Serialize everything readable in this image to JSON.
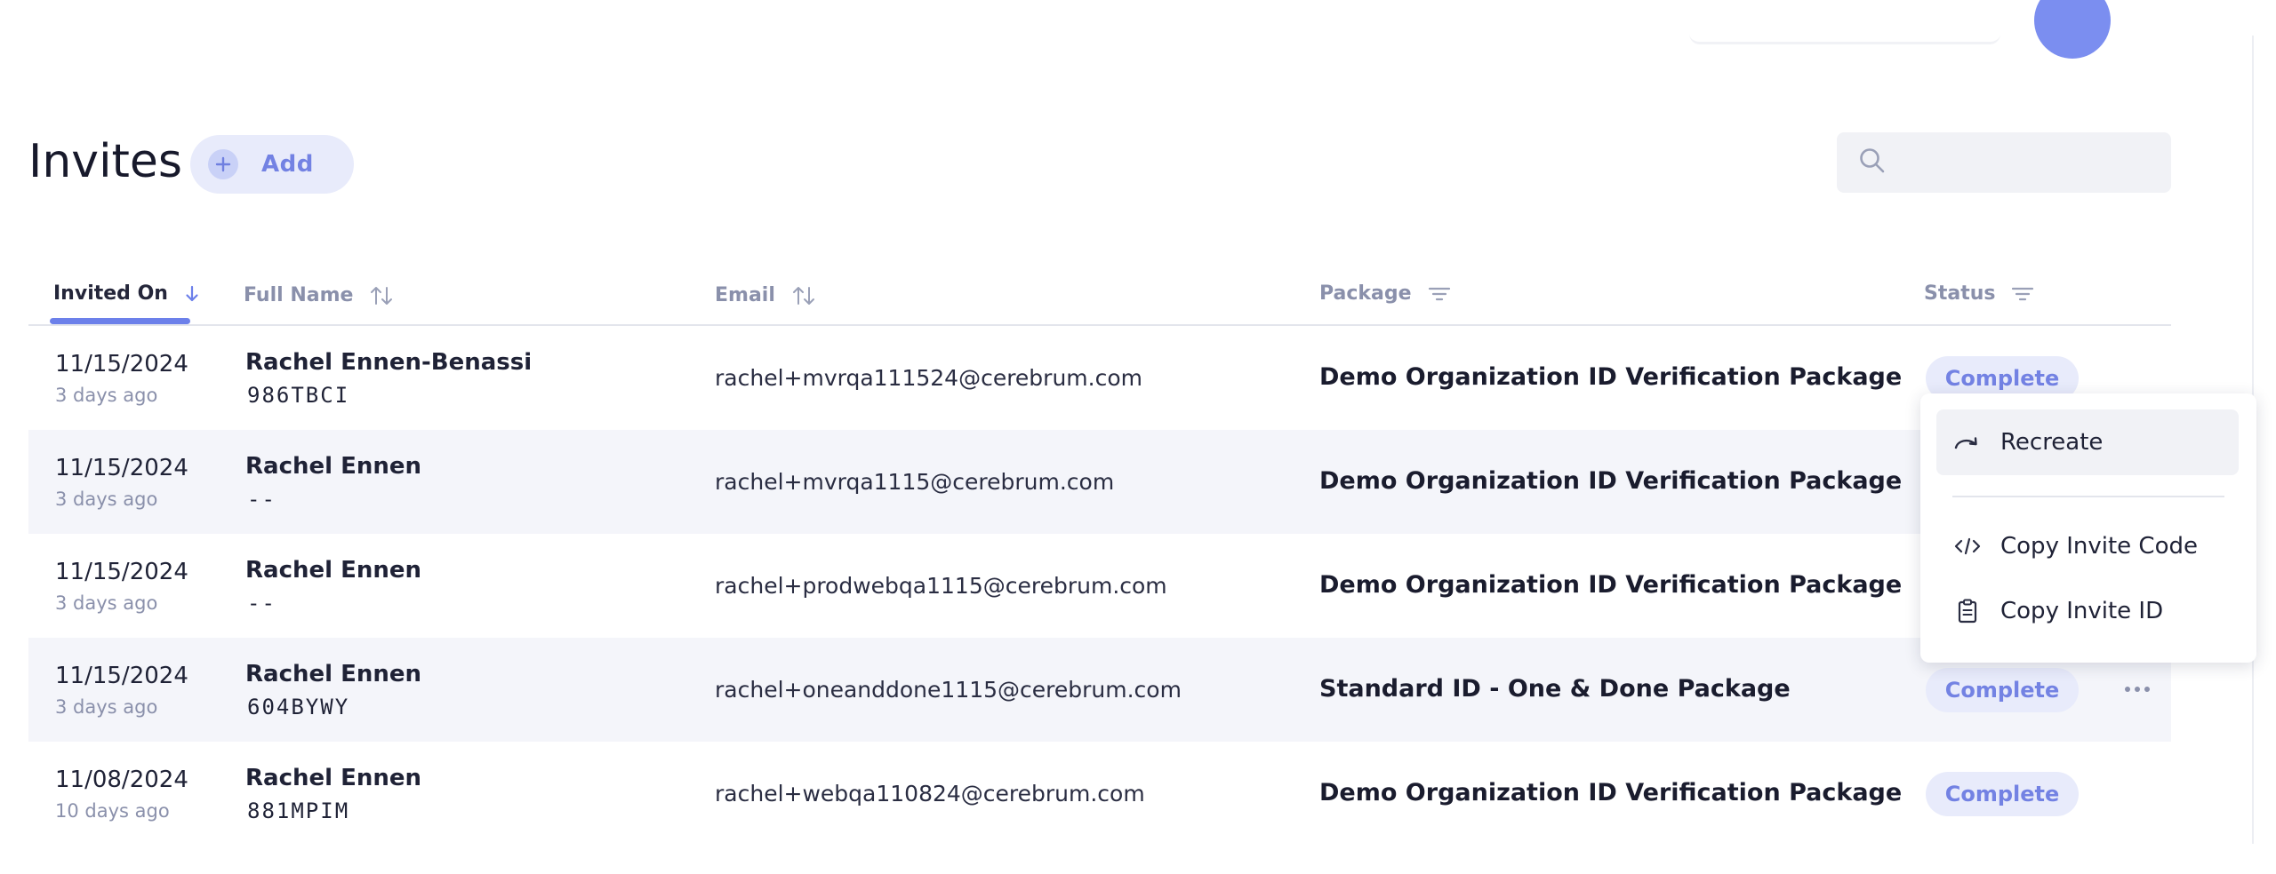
{
  "page": {
    "title": "Invites",
    "add_label": "Add",
    "search_placeholder": ""
  },
  "table": {
    "columns": [
      {
        "label": "Invited On",
        "control": "sort-descending"
      },
      {
        "label": "Full Name",
        "control": "sort"
      },
      {
        "label": "Email",
        "control": "sort"
      },
      {
        "label": "Package",
        "control": "filter"
      },
      {
        "label": "Status",
        "control": "filter"
      }
    ],
    "rows": [
      {
        "date": "11/15/2024",
        "ago": "3 days ago",
        "name": "Rachel Ennen-Benassi",
        "code": "986TBCI",
        "email": "rachel+mvrqa111524@cerebrum.com",
        "package": "Demo Organization ID Verification Package",
        "status": "Complete"
      },
      {
        "date": "11/15/2024",
        "ago": "3 days ago",
        "name": "Rachel Ennen",
        "code": "--",
        "email": "rachel+mvrqa1115@cerebrum.com",
        "package": "Demo Organization ID Verification Package",
        "status": ""
      },
      {
        "date": "11/15/2024",
        "ago": "3 days ago",
        "name": "Rachel Ennen",
        "code": "--",
        "email": "rachel+prodwebqa1115@cerebrum.com",
        "package": "Demo Organization ID Verification Package",
        "status": ""
      },
      {
        "date": "11/15/2024",
        "ago": "3 days ago",
        "name": "Rachel Ennen",
        "code": "604BYWY",
        "email": "rachel+oneanddone1115@cerebrum.com",
        "package": "Standard ID - One & Done Package",
        "status": "Complete"
      },
      {
        "date": "11/08/2024",
        "ago": "10 days ago",
        "name": "Rachel Ennen",
        "code": "881MPIM",
        "email": "rachel+webqa110824@cerebrum.com",
        "package": "Demo Organization ID Verification Package",
        "status": "Complete"
      }
    ]
  },
  "context_menu": {
    "items": [
      {
        "label": "Recreate",
        "icon": "recreate-icon"
      },
      {
        "label": "Copy Invite Code",
        "icon": "code-icon"
      },
      {
        "label": "Copy Invite ID",
        "icon": "clipboard-icon"
      }
    ]
  },
  "colors": {
    "accent": "#6c80ea",
    "badge_bg": "#e8ebfb",
    "badge_text": "#7382e3",
    "row_alt": "#f4f5fa"
  }
}
